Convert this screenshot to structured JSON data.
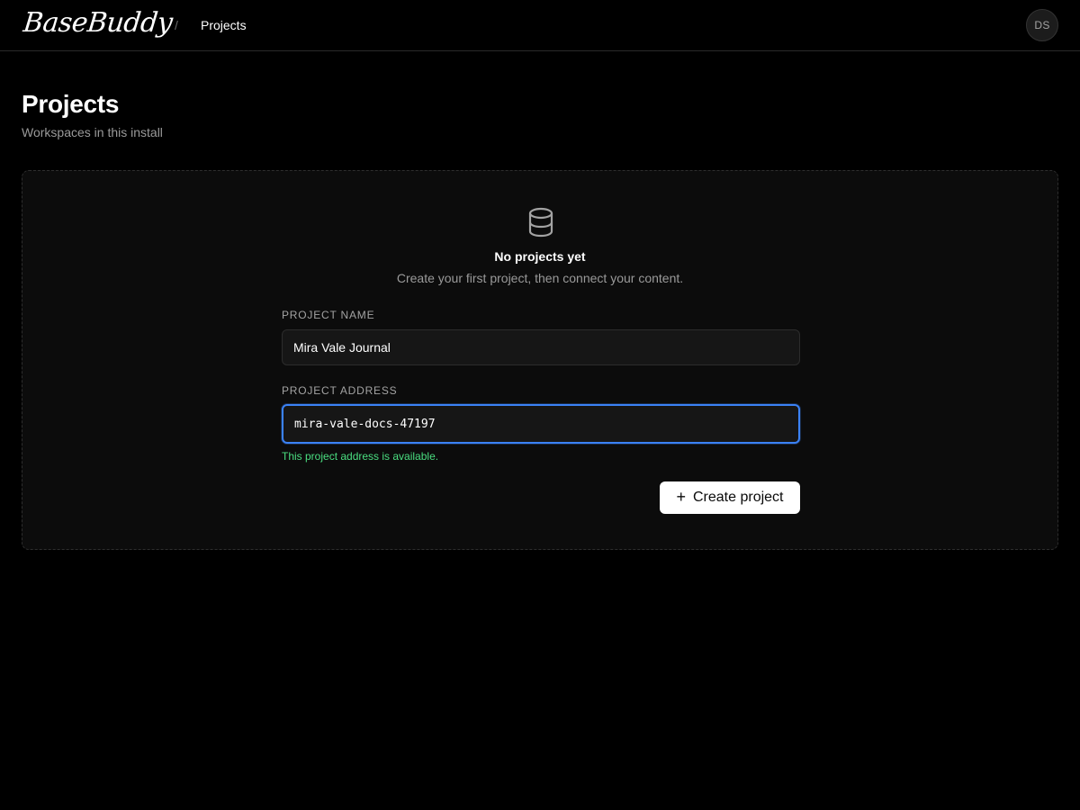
{
  "header": {
    "logo_text": "BaseBuddy",
    "breadcrumb_separator": "/",
    "breadcrumb_current": "Projects",
    "avatar_initials": "DS"
  },
  "page": {
    "title": "Projects",
    "subtitle": "Workspaces in this install"
  },
  "empty_state": {
    "icon": "database-icon",
    "title": "No projects yet",
    "description": "Create your first project, then connect your content."
  },
  "form": {
    "project_name": {
      "label": "PROJECT NAME",
      "value": "Mira Vale Journal"
    },
    "project_address": {
      "label": "PROJECT ADDRESS",
      "value": "mira-vale-docs-47197",
      "hint": "This project address is available."
    },
    "create_button": {
      "icon": "plus-icon",
      "label": "Create project"
    }
  },
  "colors": {
    "background": "#000000",
    "focus_ring": "#3b82f6",
    "success_text": "#4ade80",
    "button_bg": "#ffffff"
  }
}
